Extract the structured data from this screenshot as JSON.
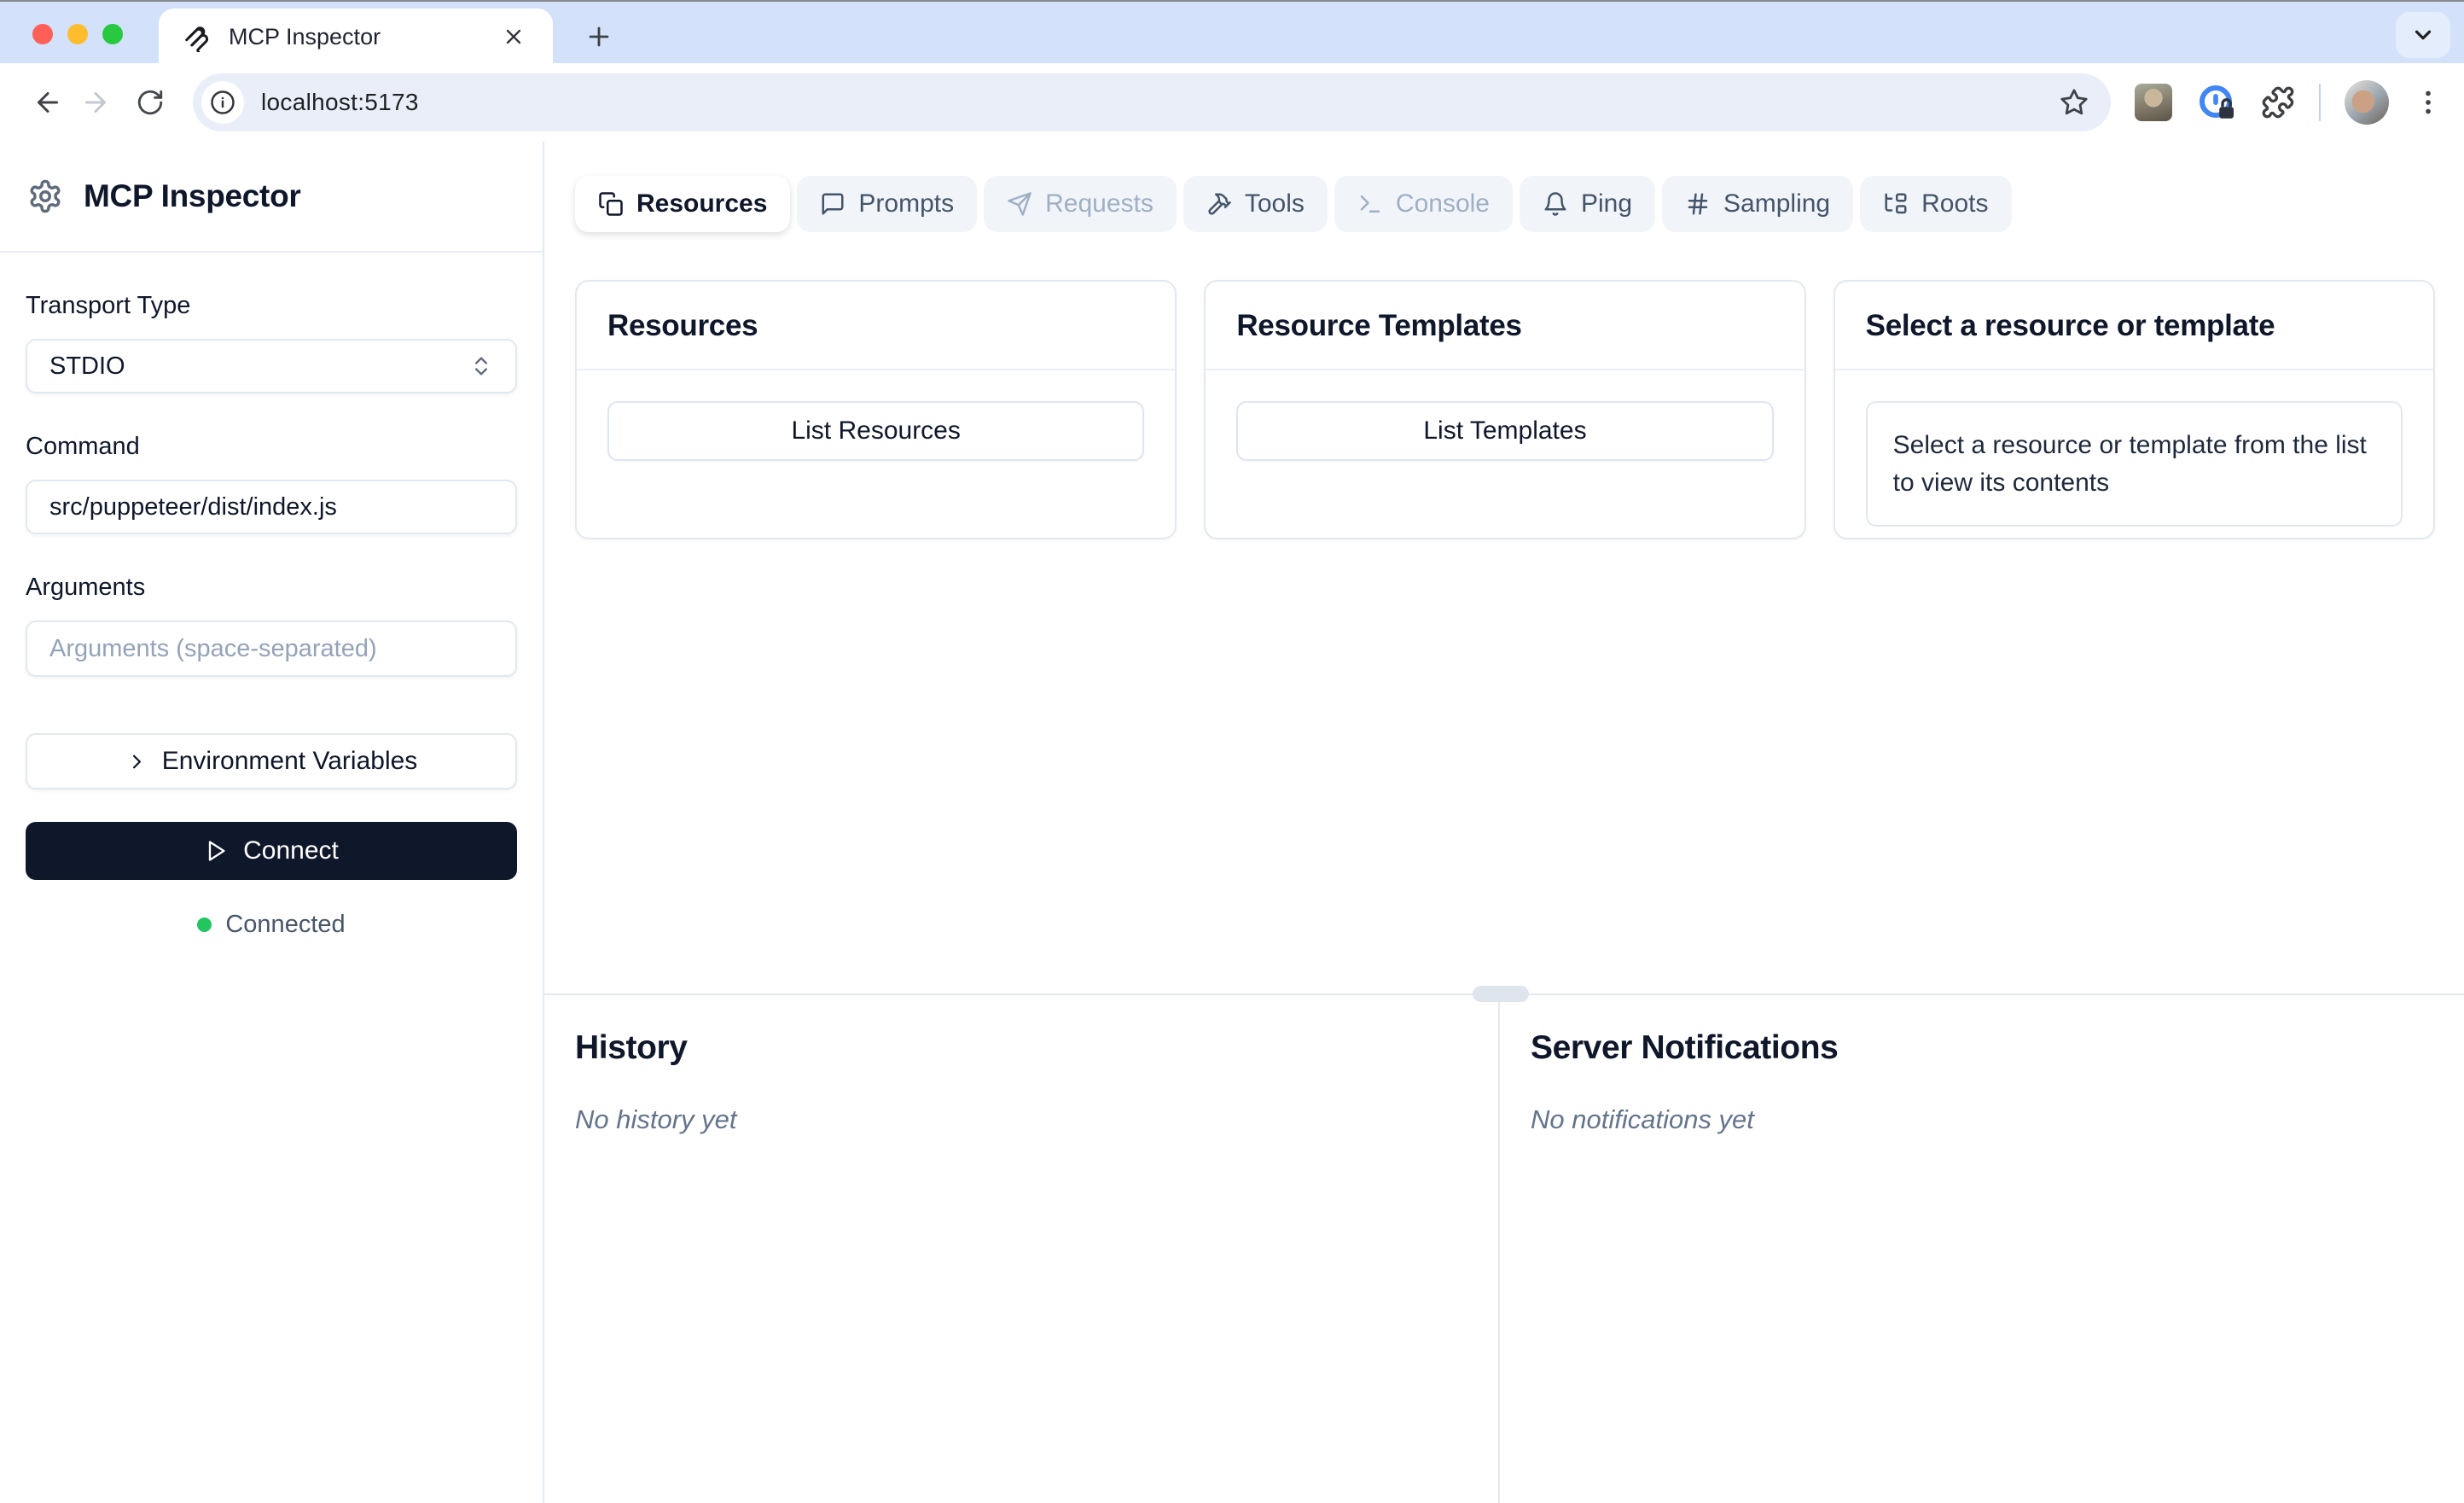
{
  "browser": {
    "tab_title": "MCP Inspector",
    "url": "localhost:5173"
  },
  "sidebar": {
    "title": "MCP Inspector",
    "transport_label": "Transport Type",
    "transport_value": "STDIO",
    "command_label": "Command",
    "command_value": "src/puppeteer/dist/index.js",
    "arguments_label": "Arguments",
    "arguments_placeholder": "Arguments (space-separated)",
    "env_button_label": "Environment Variables",
    "connect_button_label": "Connect",
    "status_text": "Connected"
  },
  "tabs": [
    {
      "label": "Resources",
      "state": "active"
    },
    {
      "label": "Prompts",
      "state": "normal"
    },
    {
      "label": "Requests",
      "state": "disabled"
    },
    {
      "label": "Tools",
      "state": "normal"
    },
    {
      "label": "Console",
      "state": "disabled"
    },
    {
      "label": "Ping",
      "state": "normal"
    },
    {
      "label": "Sampling",
      "state": "normal"
    },
    {
      "label": "Roots",
      "state": "normal"
    }
  ],
  "cards": {
    "resources": {
      "title": "Resources",
      "button_label": "List Resources"
    },
    "templates": {
      "title": "Resource Templates",
      "button_label": "List Templates"
    },
    "preview": {
      "title": "Select a resource or template",
      "message": "Select a resource or template from the list to view its contents"
    }
  },
  "panes": {
    "history": {
      "title": "History",
      "empty_text": "No history yet"
    },
    "notifications": {
      "title": "Server Notifications",
      "empty_text": "No notifications yet"
    }
  },
  "colors": {
    "chrome_background": "#d3e2fa",
    "connect_button": "#0f172a",
    "status_green": "#22c55e",
    "border": "#e2e8f0",
    "muted_text": "#64748b",
    "tab_pill": "#f1f5f9"
  }
}
